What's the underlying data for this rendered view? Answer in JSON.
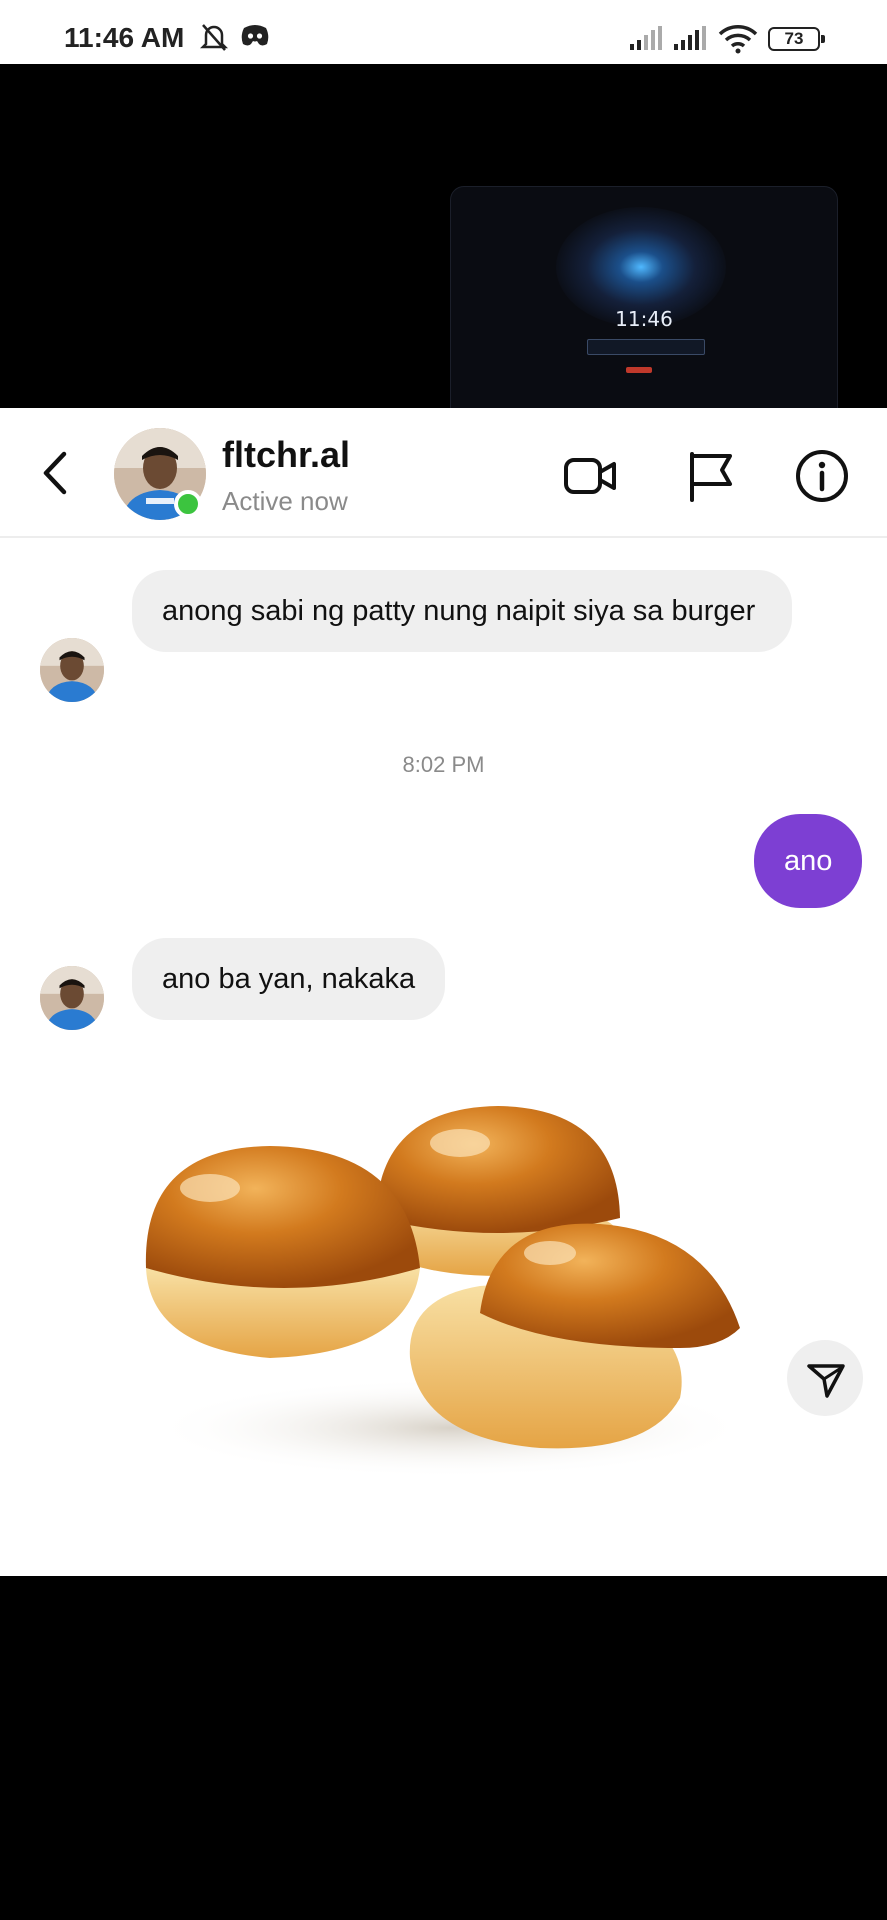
{
  "status_bar": {
    "time": "11:46 AM",
    "battery": "73",
    "icons": [
      "mute-bell-icon",
      "discord-icon",
      "signal-icon",
      "signal-icon",
      "wifi-icon",
      "battery-icon"
    ]
  },
  "screen_share": {
    "thumbnail_time": "11:46"
  },
  "header": {
    "username": "fltchr.al",
    "status": "Active now",
    "icons": [
      "back-icon",
      "video-call-icon",
      "flag-icon",
      "info-icon"
    ]
  },
  "messages": [
    {
      "from": "them",
      "text": "anong sabi ng patty nung naipit siya sa burger"
    },
    {
      "type": "timestamp",
      "text": "8:02 PM"
    },
    {
      "from": "me",
      "text": "ano"
    },
    {
      "from": "them",
      "text": "ano ba yan, nakaka"
    },
    {
      "from": "them",
      "type": "image",
      "icon": "share-icon"
    }
  ],
  "colors": {
    "outgoing_bubble": "#7d3fd3",
    "incoming_bubble": "#efefef",
    "online": "#3cc43f"
  }
}
